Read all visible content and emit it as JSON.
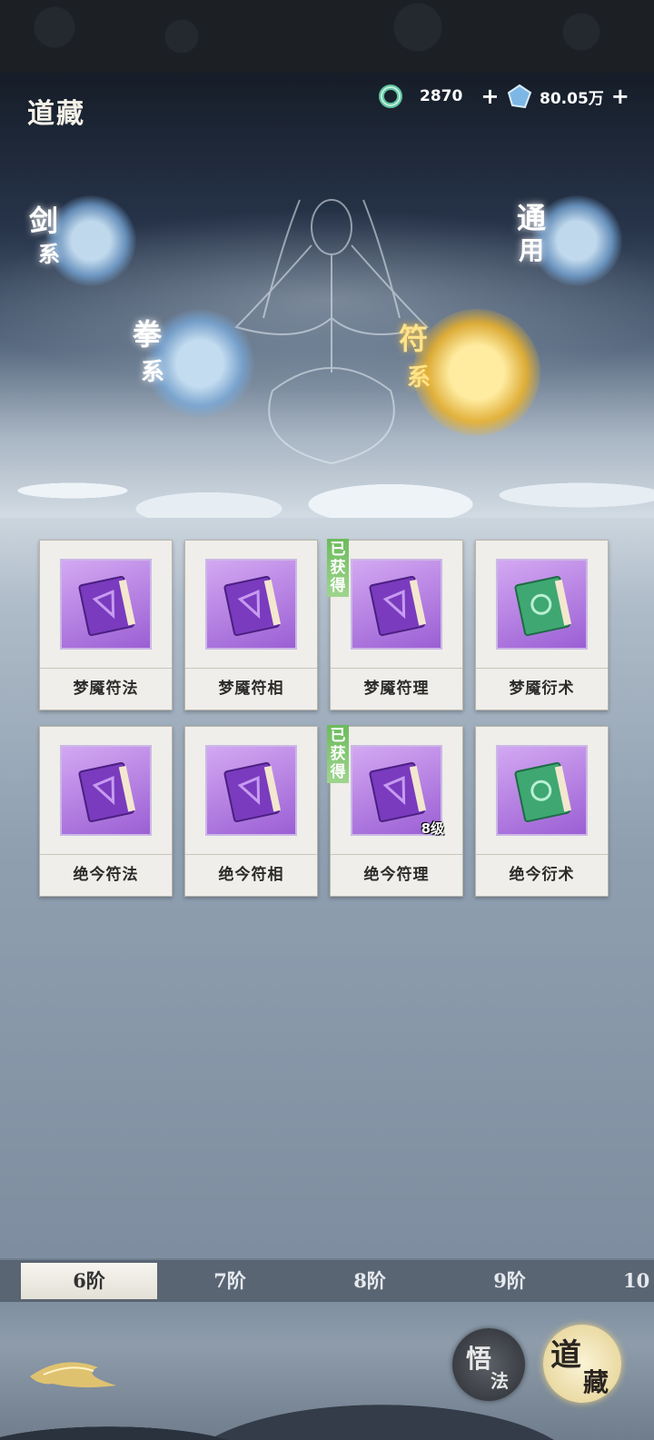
{
  "header": {
    "title": "道藏"
  },
  "resources": [
    {
      "icon": "jade-ring-icon",
      "value": "2870",
      "plus": "+"
    },
    {
      "icon": "spirit-crystal-icon",
      "value": "80.05万",
      "plus": "+"
    }
  ],
  "schools": [
    {
      "key": "sword",
      "label_top": "剑",
      "label_bottom": "系",
      "state": "normal"
    },
    {
      "key": "general",
      "label_top": "通",
      "label_bottom": "用",
      "state": "normal"
    },
    {
      "key": "fist",
      "label_top": "拳",
      "label_bottom": "系",
      "state": "normal"
    },
    {
      "key": "talisman",
      "label_top": "符",
      "label_bottom": "系",
      "state": "selected"
    }
  ],
  "books": [
    {
      "name": "梦魇符法",
      "color": "purple",
      "acquired": false,
      "level": ""
    },
    {
      "name": "梦魇符相",
      "color": "purple",
      "acquired": false,
      "level": ""
    },
    {
      "name": "梦魇符理",
      "color": "purple",
      "acquired": true,
      "level": ""
    },
    {
      "name": "梦魇衍术",
      "color": "green",
      "acquired": false,
      "level": ""
    },
    {
      "name": "绝今符法",
      "color": "purple",
      "acquired": false,
      "level": ""
    },
    {
      "name": "绝今符相",
      "color": "purple",
      "acquired": false,
      "level": ""
    },
    {
      "name": "绝今符理",
      "color": "purple",
      "acquired": true,
      "level": "8级"
    },
    {
      "name": "绝今衍术",
      "color": "green",
      "acquired": false,
      "level": ""
    }
  ],
  "acquired_label": "已获得",
  "tiers": [
    "6阶",
    "7阶",
    "8阶",
    "9阶",
    "10"
  ],
  "active_tier": "6阶",
  "bottom_buttons": {
    "enlighten_top": "悟",
    "enlighten_bottom": "法",
    "dao_top": "道",
    "dao_bottom": "藏"
  },
  "colors": {
    "book_purple": "#9b5fd4",
    "book_green": "#3fa772",
    "acquired_badge": "#6cbb5c",
    "selected_orb": "#f0b428"
  }
}
